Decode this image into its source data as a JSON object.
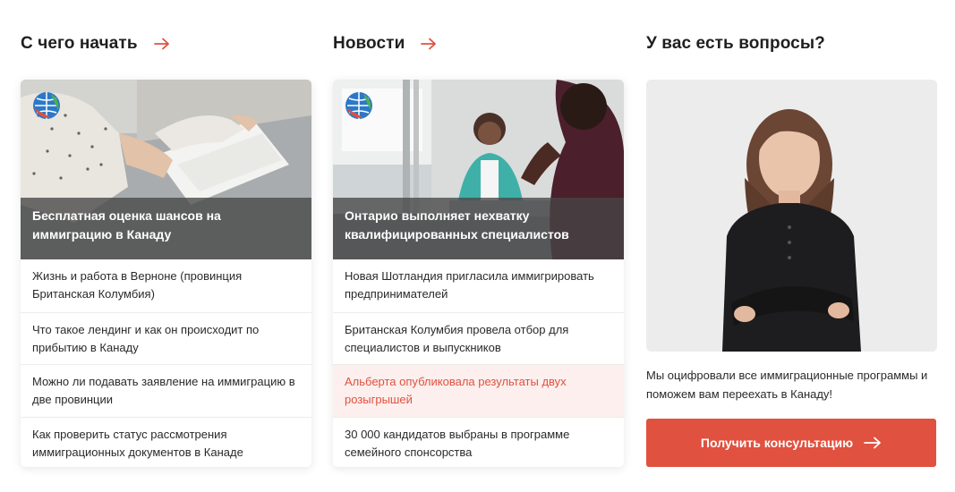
{
  "columns": [
    {
      "title": "С чего начать",
      "hero_title": "Бесплатная оценка шансов на иммиграцию в Канаду",
      "items": [
        "Жизнь и работа в Верноне (провинция Британская Колумбия)",
        "Что такое лендинг и как он происходит по прибытию в Канаду",
        "Можно ли подавать заявление на иммиграцию в две провинции",
        "Как проверить статус рассмотрения иммиграционных документов в Канаде"
      ]
    },
    {
      "title": "Новости",
      "hero_title": "Онтарио выполняет нехватку квалифицированных специалистов",
      "items": [
        "Новая Шотландия пригласила иммигрировать предпринимателей",
        "Британская Колумбия провела отбор для специалистов и выпускников",
        "Альберта опубликовала результаты двух розыгрышей",
        "30 000 кандидатов выбраны в программе семейного спонсорства"
      ],
      "active_index": 2
    }
  ],
  "questions": {
    "title": "У вас есть вопросы?",
    "text": "Мы оцифровали все иммиграционные программы и поможем вам переехать в Канаду!",
    "button_label": "Получить консультацию"
  },
  "colors": {
    "accent": "#e0513f",
    "text": "#1f1f1f",
    "active_bg": "#fcefed"
  },
  "icons": {
    "title_arrow": "arrow-right-icon",
    "logo": "globe-logo-icon"
  }
}
